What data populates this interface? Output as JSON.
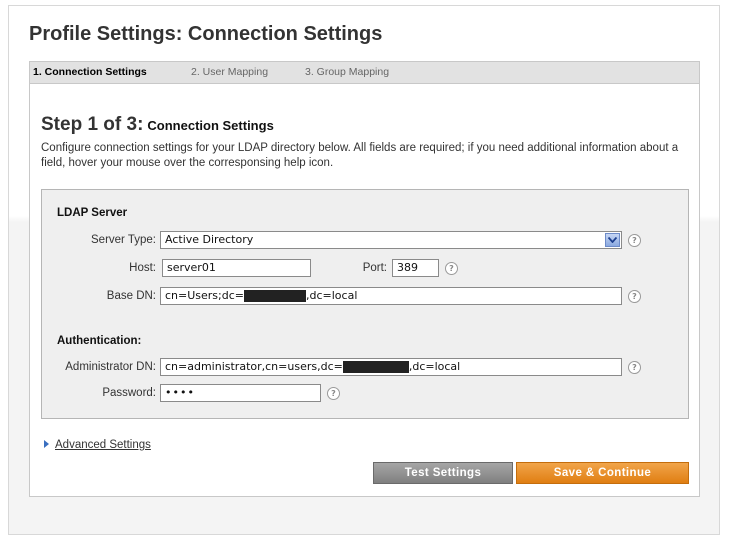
{
  "page": {
    "title": "Profile Settings: Connection Settings"
  },
  "tabs": [
    {
      "label": "1. Connection Settings",
      "active": true
    },
    {
      "label": "2. User Mapping",
      "active": false
    },
    {
      "label": "3. Group Mapping",
      "active": false
    }
  ],
  "step": {
    "heading": "Step 1 of 3:",
    "subheading": "Connection Settings",
    "description": "Configure connection settings for your LDAP directory below. All fields are required; if you need additional information about a field, hover your mouse over the corresponsing help icon."
  },
  "ldap": {
    "section_label": "LDAP Server",
    "server_type_label": "Server Type:",
    "server_type_value": "Active Directory",
    "host_label": "Host:",
    "host_value": "server01",
    "port_label": "Port:",
    "port_value": "389",
    "base_dn_label": "Base DN:",
    "base_dn_prefix": "cn=Users;dc=",
    "base_dn_suffix": ",dc=local"
  },
  "auth": {
    "section_label": "Authentication:",
    "admin_dn_label": "Administrator DN:",
    "admin_dn_prefix": "cn=administrator,cn=users,dc=",
    "admin_dn_suffix": ",dc=local",
    "password_label": "Password:",
    "password_value": "••••"
  },
  "help_icon": "?",
  "advanced": {
    "label": "Advanced Settings",
    "icon": "triangle-right-icon"
  },
  "buttons": {
    "test": "Test Settings",
    "save": "Save & Continue"
  },
  "colors": {
    "save_button": "#e88a1c",
    "test_button": "#8f8f8f",
    "link_triangle": "#3a6fc0"
  }
}
